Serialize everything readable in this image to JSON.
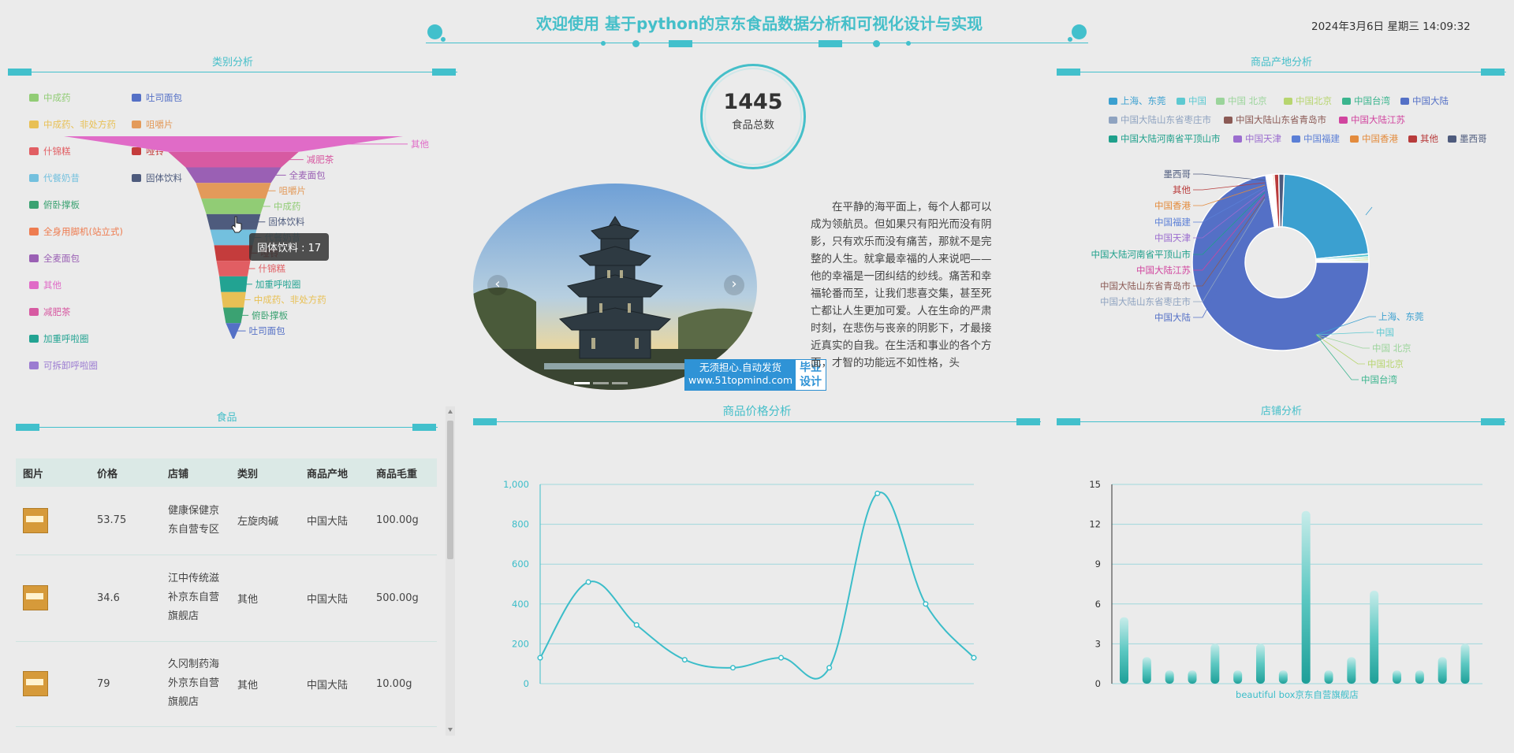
{
  "header": {
    "title": "欢迎使用 基于python的京东食品数据分析和可视化设计与实现",
    "datetime": "2024年3月6日 星期三 14:09:32"
  },
  "sections": {
    "category": "类别分析",
    "origin": "商品产地分析",
    "food": "食品",
    "price": "商品价格分析",
    "shop": "店铺分析"
  },
  "total": {
    "count": "1445",
    "label": "食品总数"
  },
  "category_legend": [
    {
      "label": "中成药",
      "color": "#91cc75"
    },
    {
      "label": "吐司面包",
      "color": "#5470c6"
    },
    {
      "label": "中成药、非处方药",
      "color": "#e8c055"
    },
    {
      "label": "咀嚼片",
      "color": "#e39a5a"
    },
    {
      "label": "什锦糕",
      "color": "#e15e63"
    },
    {
      "label": "哑铃",
      "color": "#c43c3c"
    },
    {
      "label": "代餐奶昔",
      "color": "#73c0de"
    },
    {
      "label": "固体饮料",
      "color": "#4e5b7d"
    },
    {
      "label": "俯卧撑板",
      "color": "#3ba272"
    },
    {
      "label": "全身用脚机(站立式)",
      "color": "#ee7c50"
    },
    {
      "label": "全麦面包",
      "color": "#9a60b4"
    },
    {
      "label": "其他",
      "color": "#e06bc7"
    },
    {
      "label": "减肥茶",
      "color": "#d75aa2"
    },
    {
      "label": "加重呼啦圈",
      "color": "#22a392"
    },
    {
      "label": "可拆卸呼啦圈",
      "color": "#9b7bd1"
    }
  ],
  "funnel_labels": [
    "其他",
    "减肥茶",
    "全麦面包",
    "咀嚼片",
    "中成药",
    "固体饮料",
    "代餐奶昔",
    "哑铃",
    "什锦糕",
    "加重呼啦圈",
    "中成药、非处方药",
    "俯卧撑板",
    "吐司面包"
  ],
  "tooltip": "固体饮料 : 17",
  "carousel": {
    "prev": "‹",
    "next": "›"
  },
  "badge": {
    "left1": "无须担心.自动发货",
    "left2": "www.51topmind.com",
    "right1": "毕业",
    "right2": "设计"
  },
  "paragraph": "在平静的海平面上，每个人都可以成为领航员。但如果只有阳光而没有阴影，只有欢乐而没有痛苦，那就不是完整的人生。就拿最幸福的人来说吧——他的幸福是一团纠结的纱线。痛苦和幸福轮番而至，让我们悲喜交集，甚至死亡都让人生更加可爱。人在生命的严肃时刻，在悲伤与丧亲的阴影下，才最接近真实的自我。在生活和事业的各个方面，才智的功能远不如性格，头",
  "origin_legend": [
    {
      "label": "上海、东莞",
      "color": "#3ba0d0"
    },
    {
      "label": "中国",
      "color": "#5dc9d1"
    },
    {
      "label": "中国 北京",
      "color": "#9bd49b"
    },
    {
      "label": "中国北京",
      "color": "#b7d56f"
    },
    {
      "label": "中国台湾",
      "color": "#3bb58e"
    },
    {
      "label": "中国大陆",
      "color": "#5470c6"
    },
    {
      "label": "中国大陆山东省枣庄市",
      "color": "#8fa3c0"
    },
    {
      "label": "中国大陆山东省青岛市",
      "color": "#8b5a55"
    },
    {
      "label": "中国大陆江苏",
      "color": "#d1459f"
    },
    {
      "label": "中国大陆河南省平顶山市",
      "color": "#1fa08b"
    },
    {
      "label": "中国天津",
      "color": "#9b6dcf"
    },
    {
      "label": "中国福建",
      "color": "#5b7fd6"
    },
    {
      "label": "中国香港",
      "color": "#e38b3d"
    },
    {
      "label": "其他",
      "color": "#b83b3b"
    },
    {
      "label": "墨西哥",
      "color": "#4e5b7d"
    }
  ],
  "pie_labels_left": [
    "墨西哥",
    "其他",
    "中国香港",
    "中国福建",
    "中国天津",
    "中国大陆河南省平顶山市",
    "中国大陆江苏",
    "中国大陆山东省青岛市",
    "中国大陆山东省枣庄市",
    "中国大陆"
  ],
  "pie_labels_right": [
    "上海、东莞",
    "中国",
    "中国 北京",
    "中国北京",
    "中国台湾"
  ],
  "table": {
    "headers": [
      "图片",
      "价格",
      "店铺",
      "类别",
      "商品产地",
      "商品毛重"
    ],
    "rows": [
      {
        "price": "53.75",
        "shop": "健康保健京东自营专区",
        "category": "左旋肉碱",
        "origin": "中国大陆",
        "weight": "100.00g"
      },
      {
        "price": "34.6",
        "shop": "江中传统滋补京东自营旗舰店",
        "category": "其他",
        "origin": "中国大陆",
        "weight": "500.00g"
      },
      {
        "price": "79",
        "shop": "久冈制药海外京东自营旗舰店",
        "category": "其他",
        "origin": "中国大陆",
        "weight": "10.00g"
      }
    ]
  },
  "chart_data": [
    {
      "type": "line",
      "title": "商品价格分析",
      "x": [
        1,
        2,
        3,
        4,
        5,
        6,
        7,
        8,
        9,
        10
      ],
      "values": [
        130,
        510,
        295,
        120,
        80,
        130,
        80,
        955,
        400,
        130
      ],
      "ylim": [
        0,
        1000
      ],
      "yticks": [
        "0",
        "200",
        "400",
        "600",
        "800",
        "1,000"
      ],
      "color": "#3bbdc9",
      "smooth": true
    },
    {
      "type": "bar",
      "title": "店铺分析",
      "categories_visible": [
        "beautiful box京东自营旗舰店"
      ],
      "values": [
        5,
        2,
        1,
        1,
        3,
        1,
        3,
        1,
        13,
        1,
        2,
        7,
        1,
        1,
        2,
        3
      ],
      "ylim": [
        0,
        15
      ],
      "yticks": [
        "0",
        "3",
        "6",
        "9",
        "12",
        "15"
      ],
      "color": "#1fa9a0"
    },
    {
      "type": "pie",
      "title": "商品产地分析",
      "slices": [
        {
          "label": "上海、东莞",
          "value": 330,
          "color": "#3ba0d0"
        },
        {
          "label": "中国",
          "value": 8,
          "color": "#5dc9d1"
        },
        {
          "label": "中国 北京",
          "value": 5,
          "color": "#9bd49b"
        },
        {
          "label": "中国北京",
          "value": 5,
          "color": "#b7d56f"
        },
        {
          "label": "中国台湾",
          "value": 4,
          "color": "#3bb58e"
        },
        {
          "label": "中国大陆",
          "value": 1045,
          "color": "#5470c6"
        },
        {
          "label": "中国大陆山东省枣庄市",
          "value": 3,
          "color": "#8fa3c0"
        },
        {
          "label": "中国大陆山东省青岛市",
          "value": 3,
          "color": "#8b5a55"
        },
        {
          "label": "中国大陆江苏",
          "value": 3,
          "color": "#d1459f"
        },
        {
          "label": "中国大陆河南省平顶山市",
          "value": 3,
          "color": "#1fa08b"
        },
        {
          "label": "中国天津",
          "value": 3,
          "color": "#9b6dcf"
        },
        {
          "label": "中国福建",
          "value": 3,
          "color": "#5b7fd6"
        },
        {
          "label": "中国香港",
          "value": 4,
          "color": "#e38b3d"
        },
        {
          "label": "其他",
          "value": 12,
          "color": "#b83b3b"
        },
        {
          "label": "墨西哥",
          "value": 14,
          "color": "#4e5b7d"
        }
      ]
    },
    {
      "type": "funnel",
      "title": "类别分析",
      "categories": [
        "其他",
        "减肥茶",
        "全麦面包",
        "咀嚼片",
        "中成药",
        "固体饮料",
        "代餐奶昔",
        "哑铃",
        "什锦糕",
        "加重呼啦圈",
        "中成药、非处方药",
        "俯卧撑板",
        "吐司面包"
      ],
      "values": [
        1000,
        120,
        60,
        35,
        25,
        17,
        12,
        8,
        6,
        4,
        3,
        2,
        1
      ]
    }
  ]
}
